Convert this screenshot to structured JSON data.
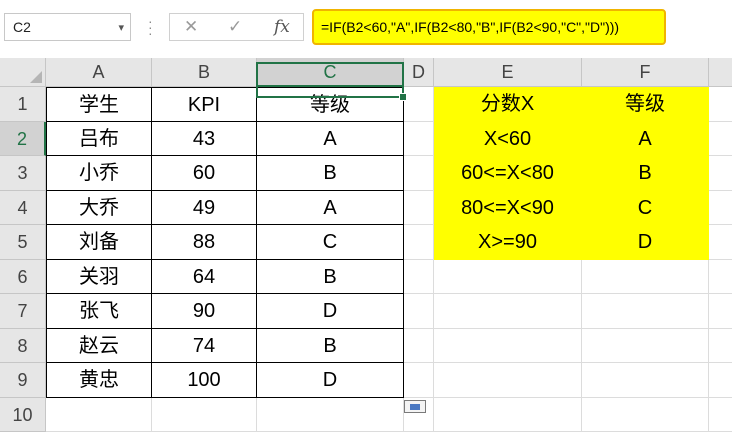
{
  "formula_bar": {
    "name_box": "C2",
    "cancel_icon": "✕",
    "enter_icon": "✓",
    "function_icon": "fx",
    "formula": "=IF(B2<60,\"A\",IF(B2<80,\"B\",IF(B2<90,\"C\",\"D\")))"
  },
  "columns": [
    "A",
    "B",
    "C",
    "D",
    "E",
    "F"
  ],
  "selected_column": "C",
  "rows": [
    "1",
    "2",
    "3",
    "4",
    "5",
    "6",
    "7",
    "8",
    "9",
    "10"
  ],
  "selected_row": "2",
  "table": {
    "headers": [
      "学生",
      "KPI",
      "等级"
    ],
    "data": [
      [
        "吕布",
        "43",
        "A"
      ],
      [
        "小乔",
        "60",
        "B"
      ],
      [
        "大乔",
        "49",
        "A"
      ],
      [
        "刘备",
        "88",
        "C"
      ],
      [
        "关羽",
        "64",
        "B"
      ],
      [
        "张飞",
        "90",
        "D"
      ],
      [
        "赵云",
        "74",
        "B"
      ],
      [
        "黄忠",
        "100",
        "D"
      ]
    ]
  },
  "lookup": {
    "headers": [
      "分数X",
      "等级"
    ],
    "data": [
      [
        "X<60",
        "A"
      ],
      [
        "60<=X<80",
        "B"
      ],
      [
        "80<=X<90",
        "C"
      ],
      [
        "X>=90",
        "D"
      ]
    ]
  },
  "colors": {
    "highlight": "#ffff00",
    "formula_border": "#f0b400",
    "selection": "#217346"
  }
}
